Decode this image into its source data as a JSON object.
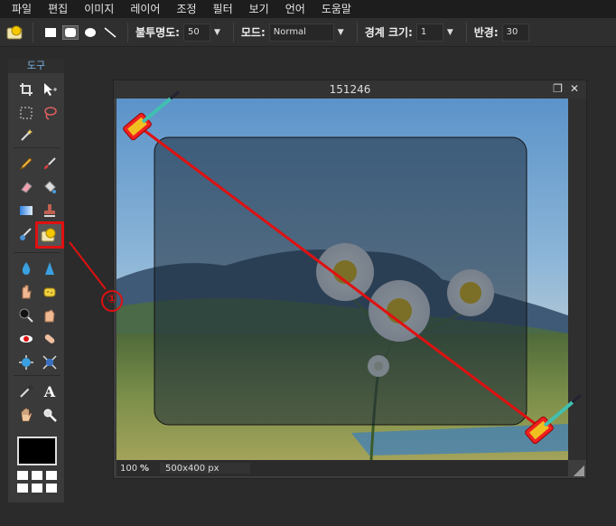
{
  "menu": [
    "파일",
    "편집",
    "이미지",
    "레이어",
    "조정",
    "필터",
    "보기",
    "언어",
    "도움말"
  ],
  "options": {
    "opacity_label": "불투명도:",
    "opacity_value": "50",
    "mode_label": "모드:",
    "mode_value": "Normal",
    "border_label": "경계 크기:",
    "border_value": "1",
    "radius_label": "반경:",
    "radius_value": "30"
  },
  "toolbox": {
    "title": "도구",
    "tools": [
      "crop-icon",
      "move-icon",
      "marquee-icon",
      "lasso-icon",
      "magic-wand-icon",
      "pencil-icon",
      "brush-icon",
      "eraser-icon",
      "fill-bucket-icon",
      "gradient-icon",
      "clone-stamp-icon",
      "color-replace-icon",
      "drawing-tool-icon",
      "blur-icon",
      "sharpen-icon",
      "smudge-icon",
      "sponge-icon",
      "dodge-icon",
      "burn-icon",
      "red-eye-icon",
      "spot-heal-icon",
      "bloat-icon",
      "pinch-icon",
      "color-picker-icon",
      "type-icon",
      "hand-icon",
      "zoom-icon"
    ],
    "type_glyph": "A"
  },
  "document": {
    "title": "151246",
    "zoom": "100",
    "zoom_unit": "%",
    "dimensions": "500x400 px"
  },
  "annotation": {
    "marker": "①",
    "color": "#e01010"
  }
}
